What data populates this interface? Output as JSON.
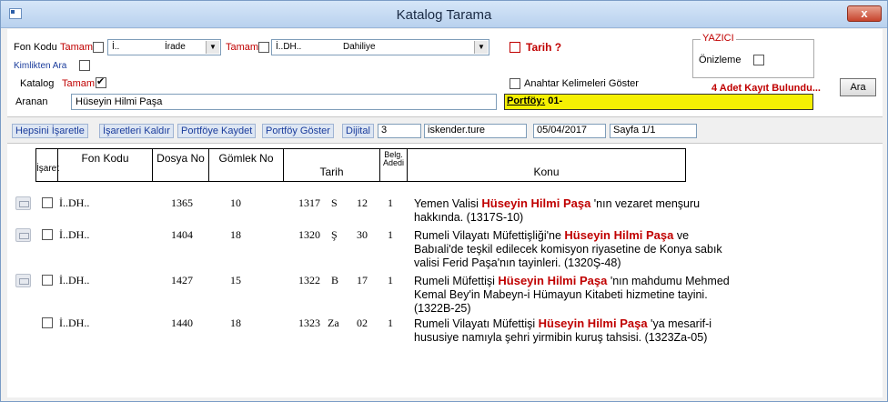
{
  "window": {
    "title": "Katalog Tarama",
    "close_label": "x"
  },
  "filters": {
    "fon_kodu_label": "Fon Kodu",
    "tamami_label": "Tamamı",
    "fon_select": {
      "code": "İ..",
      "name": "İrade"
    },
    "fon2_select": {
      "code": "İ..DH..",
      "name": "Dahiliye"
    },
    "tarih_label": "Tarih ?",
    "kimlikten_label": "Kimlikten Ara",
    "katalog_label": "Katalog",
    "aranan_label": "Aranan",
    "aranan_value": "Hüseyin Hilmi Paşa",
    "anahtar_label": "Anahtar Kelimeleri Göster",
    "portfoy_label": "Portföy:",
    "portfoy_value": "01-",
    "result_count": "4 Adet Kayıt Bulundu...",
    "ara_button": "Ara"
  },
  "yazici": {
    "legend": "YAZICI",
    "onizleme_label": "Önizleme"
  },
  "toolbar": {
    "hepsini": "Hepsini İşaretle",
    "isaretleri": "İşaretleri Kaldır",
    "portfoy_kaydet": "Portföye Kaydet",
    "portfoy_goster": "Portföy Göster",
    "dijital": "Dijital",
    "count": "3",
    "user": "iskender.ture",
    "date": "05/04/2017",
    "page": "Sayfa 1/1"
  },
  "table": {
    "headers": {
      "isaret": "İşaret",
      "fon_kodu": "Fon Kodu",
      "dosya_no": "Dosya No",
      "gomlek_no": "Gömlek No",
      "tarih": "Tarih",
      "belg_adedi": "Belg. Adedi",
      "konu": "Konu"
    },
    "rows": [
      {
        "fon": "İ..DH..",
        "dosya": "1365",
        "gomlek": "10",
        "yil": "1317",
        "ay": "S",
        "gun": "12",
        "adet": "1",
        "konu_pre": "Yemen Valisi ",
        "konu_hl": "Hüseyin  Hilmi Paşa",
        "konu_post": " 'nın vezaret menşuru hakkında. (1317S-10)"
      },
      {
        "fon": "İ..DH..",
        "dosya": "1404",
        "gomlek": "18",
        "yil": "1320",
        "ay": "Ş",
        "gun": "30",
        "adet": "1",
        "konu_pre": "Rumeli Vilayatı Müfettişliği'ne ",
        "konu_hl": "Hüseyin  Hilmi Paşa",
        "konu_post": " ve Babıali'de teşkil edilecek komisyon riyasetine de Konya sabık valisi Ferid Paşa'nın tayinleri. (1320Ş-48)"
      },
      {
        "fon": "İ..DH..",
        "dosya": "1427",
        "gomlek": "15",
        "yil": "1322",
        "ay": "B",
        "gun": "17",
        "adet": "1",
        "konu_pre": "Rumeli Müfettişi ",
        "konu_hl": "Hüseyin  Hilmi Paşa",
        "konu_post": " 'nın mahdumu Mehmed Kemal Bey'in Mabeyn-i Hümayun Kitabeti hizmetine tayini. (1322B-25)"
      },
      {
        "fon": "İ..DH..",
        "dosya": "1440",
        "gomlek": "18",
        "yil": "1323",
        "ay": "Za",
        "gun": "02",
        "adet": "1",
        "konu_pre": "Rumeli Vilayatı Müfettişi ",
        "konu_hl": "Hüseyin  Hilmi Paşa",
        "konu_post": " 'ya mesarif-i hususiye namıyla şehri yirmibin kuruş tahsisi. (1323Za-05)"
      }
    ]
  }
}
